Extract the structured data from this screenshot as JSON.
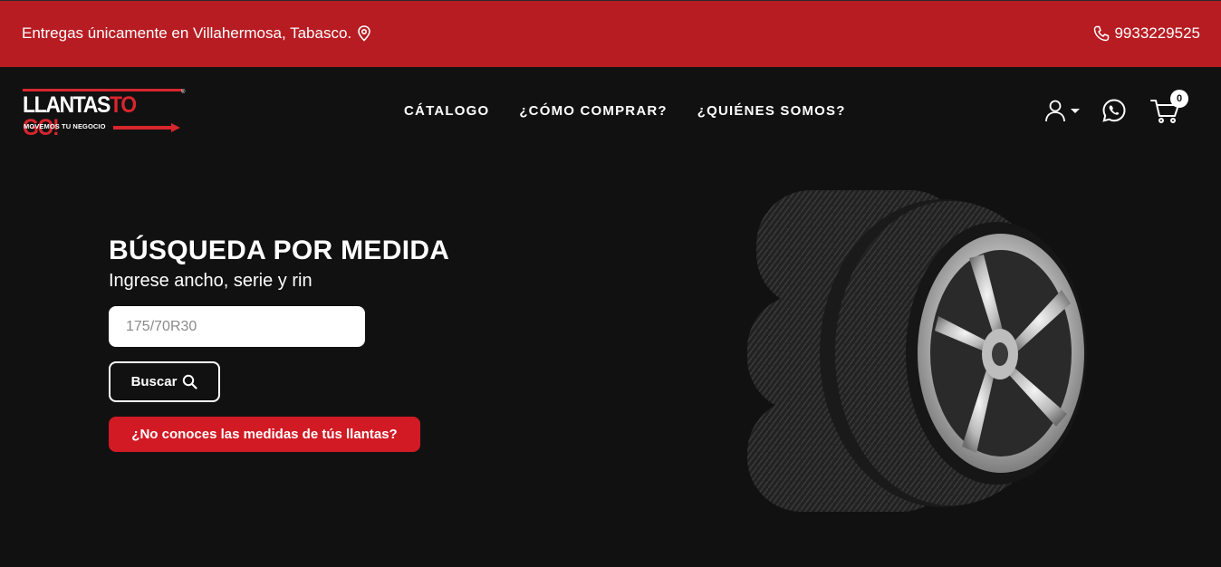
{
  "topbar": {
    "delivery_text": "Entregas únicamente en Villahermosa, Tabasco.",
    "phone": "9933229525",
    "background_color": "#b71c22"
  },
  "logo": {
    "brand_white": "LLANTAS",
    "brand_red": "TO GO!",
    "tagline": "MOVEMOS TU NEGOCIO",
    "registered": "®"
  },
  "nav": {
    "items": [
      {
        "label": "CÁTALOGO"
      },
      {
        "label": "¿CÓMO COMPRAR?"
      },
      {
        "label": "¿QUIÉNES SOMOS?"
      }
    ]
  },
  "header_icons": {
    "user": "user-icon",
    "whatsapp": "whatsapp-icon",
    "cart": "cart-icon",
    "cart_count": "0"
  },
  "hero": {
    "title": "BÚSQUEDA POR MEDIDA",
    "subtitle": "Ingrese ancho, serie y rin",
    "search_placeholder": "175/70R30",
    "search_button": "Buscar",
    "help_button": "¿No conoces las medidas de tús llantas?"
  },
  "colors": {
    "accent_red": "#d21a24",
    "background": "#111112"
  }
}
